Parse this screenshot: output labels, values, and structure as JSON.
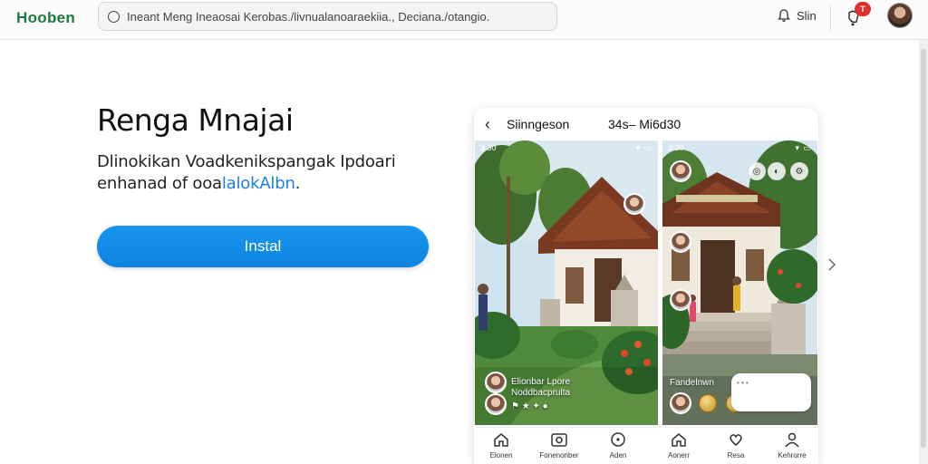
{
  "header": {
    "logo": "Hooben",
    "address": "Ineant Meng Ineaosai Kerobas./livnualanoaraekiia., Deciana./otangio.",
    "signin_label": "Slin",
    "notification_badge": "T"
  },
  "main": {
    "headline": "Renga Mnajai",
    "description_line1": "Dlinokikan Voadkenikspangak Ipdoari",
    "description_line2_prefix": "enhanad of ooa",
    "description_line2_link": "lalokAlbn",
    "description_line2_suffix": ".",
    "install_label": "Instal"
  },
  "preview": {
    "title": "Siinngeson",
    "time": "34s– Mi6d30",
    "status_time_1": "3:30",
    "status_time_2": "3:30",
    "caption_line1": "Elionbar Lpore",
    "caption_line2": "Noddbacprulta",
    "caption_bottom": "Fandelnwn",
    "tabs": [
      {
        "label": "Elonen",
        "icon": "home-icon"
      },
      {
        "label": "Fonenonber",
        "icon": "camera-icon"
      },
      {
        "label": "Aden",
        "icon": "compass-icon"
      },
      {
        "label": "Aonerr",
        "icon": "home-icon"
      },
      {
        "label": "Resa",
        "icon": "heart-icon"
      },
      {
        "label": "Kehrorre",
        "icon": "profile-icon"
      }
    ]
  },
  "colors": {
    "accent": "#0d83e0",
    "brand": "#1f7a3d",
    "badge": "#e0322c"
  }
}
